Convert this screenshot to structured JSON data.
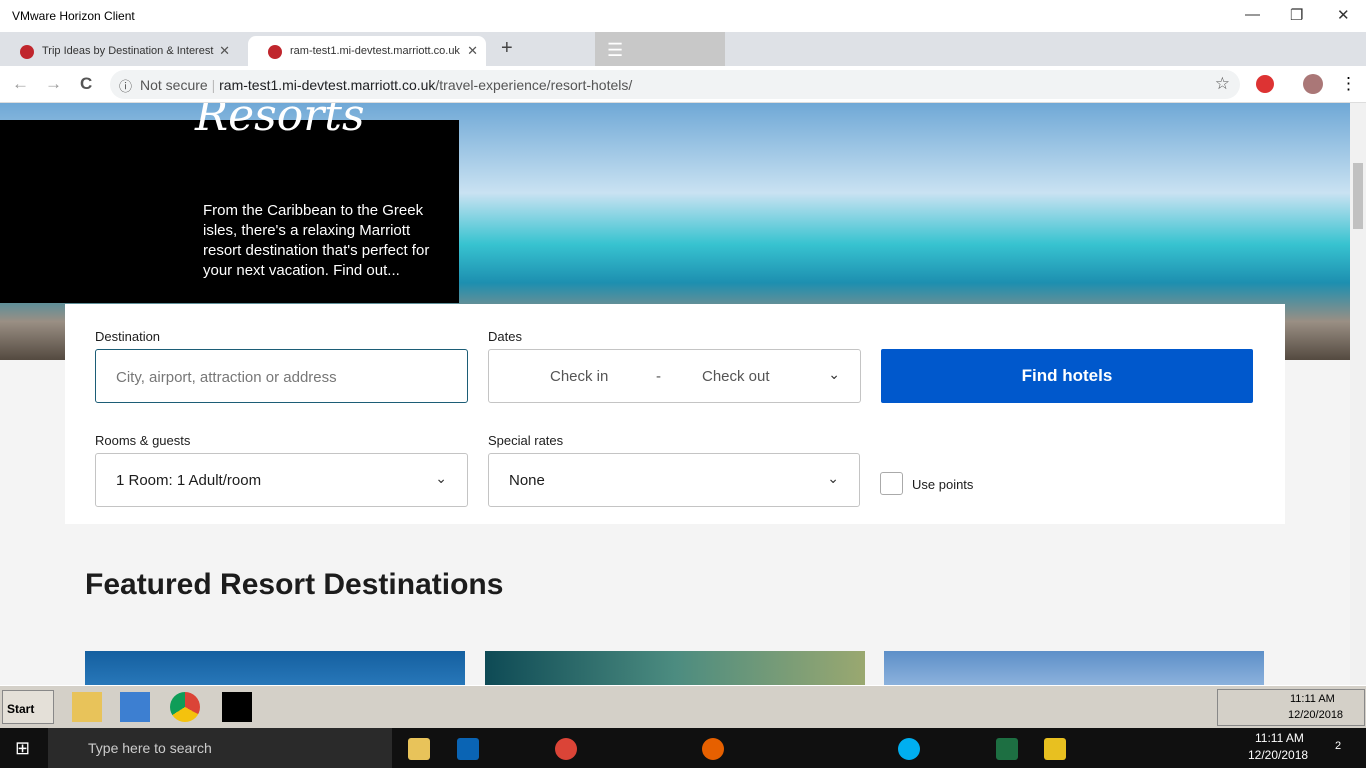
{
  "window": {
    "title": "VMware Horizon Client",
    "minimize": "—",
    "restore": "❐",
    "close": "✕"
  },
  "tabs": [
    {
      "label": "Trip Ideas by Destination & Interest",
      "close": "✕"
    },
    {
      "label": "ram-test1.mi-devtest.marriott.co.uk",
      "close": "✕"
    }
  ],
  "new_tab": "+",
  "addressbar": {
    "back": "←",
    "forward": "→",
    "reload": "C",
    "security": "Not secure",
    "url_host": "ram-test1.mi-devtest.marriott.co.uk",
    "url_path": "/travel-experience/resort-hotels/",
    "star": "☆",
    "menu": "⋮"
  },
  "hero": {
    "script_title": "Resorts",
    "description": "From the Caribbean to the Greek isles, there's a relaxing Marriott resort destination that's perfect for your next vacation. Find out..."
  },
  "search": {
    "destination_label": "Destination",
    "destination_placeholder": "City, airport, attraction or address",
    "dates_label": "Dates",
    "check_in": "Check in",
    "dash": "-",
    "check_out": "Check out",
    "find_button": "Find hotels",
    "rooms_label": "Rooms & guests",
    "rooms_value": "1 Room: 1 Adult/room",
    "rates_label": "Special rates",
    "rates_value": "None",
    "use_points": "Use points"
  },
  "featured_heading": "Featured Resort Destinations",
  "colors": {
    "accent": "#0058cc",
    "black_box": "#000000"
  },
  "vm_taskbar": {
    "start": "Start",
    "time": "11:11 AM",
    "date": "12/20/2018"
  },
  "win_taskbar": {
    "search_placeholder": "Type here to search",
    "time": "11:11 AM",
    "date": "12/20/2018",
    "notifications": "2"
  }
}
